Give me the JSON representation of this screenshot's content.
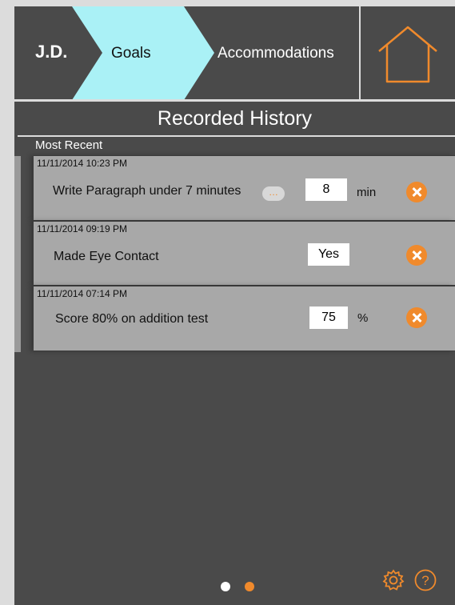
{
  "header": {
    "initials": "J.D.",
    "tabs": {
      "goals": "Goals",
      "accommodations": "Accommodations"
    }
  },
  "title": "Recorded History",
  "section_label": "Most Recent",
  "records": [
    {
      "timestamp": "11/11/2014 10:23 PM",
      "goal": "Write Paragraph under 7 minutes",
      "value": "8",
      "unit": "min",
      "note_icon_text": "…"
    },
    {
      "timestamp": "11/11/2014 09:19 PM",
      "goal": "Made Eye Contact",
      "value": "Yes",
      "unit": ""
    },
    {
      "timestamp": "11/11/2014 07:14 PM",
      "goal": "Score 80% on addition test",
      "value": "75",
      "unit": "%"
    }
  ],
  "pagination": {
    "pages": 2,
    "current": 2
  },
  "colors": {
    "accent": "#f08a2c",
    "tab_highlight": "#aaf1f6",
    "background": "#4a4a4a",
    "card": "#a8a8a8"
  },
  "icons": [
    "home-icon",
    "remove-icon",
    "note-icon",
    "gear-icon",
    "help-icon"
  ]
}
